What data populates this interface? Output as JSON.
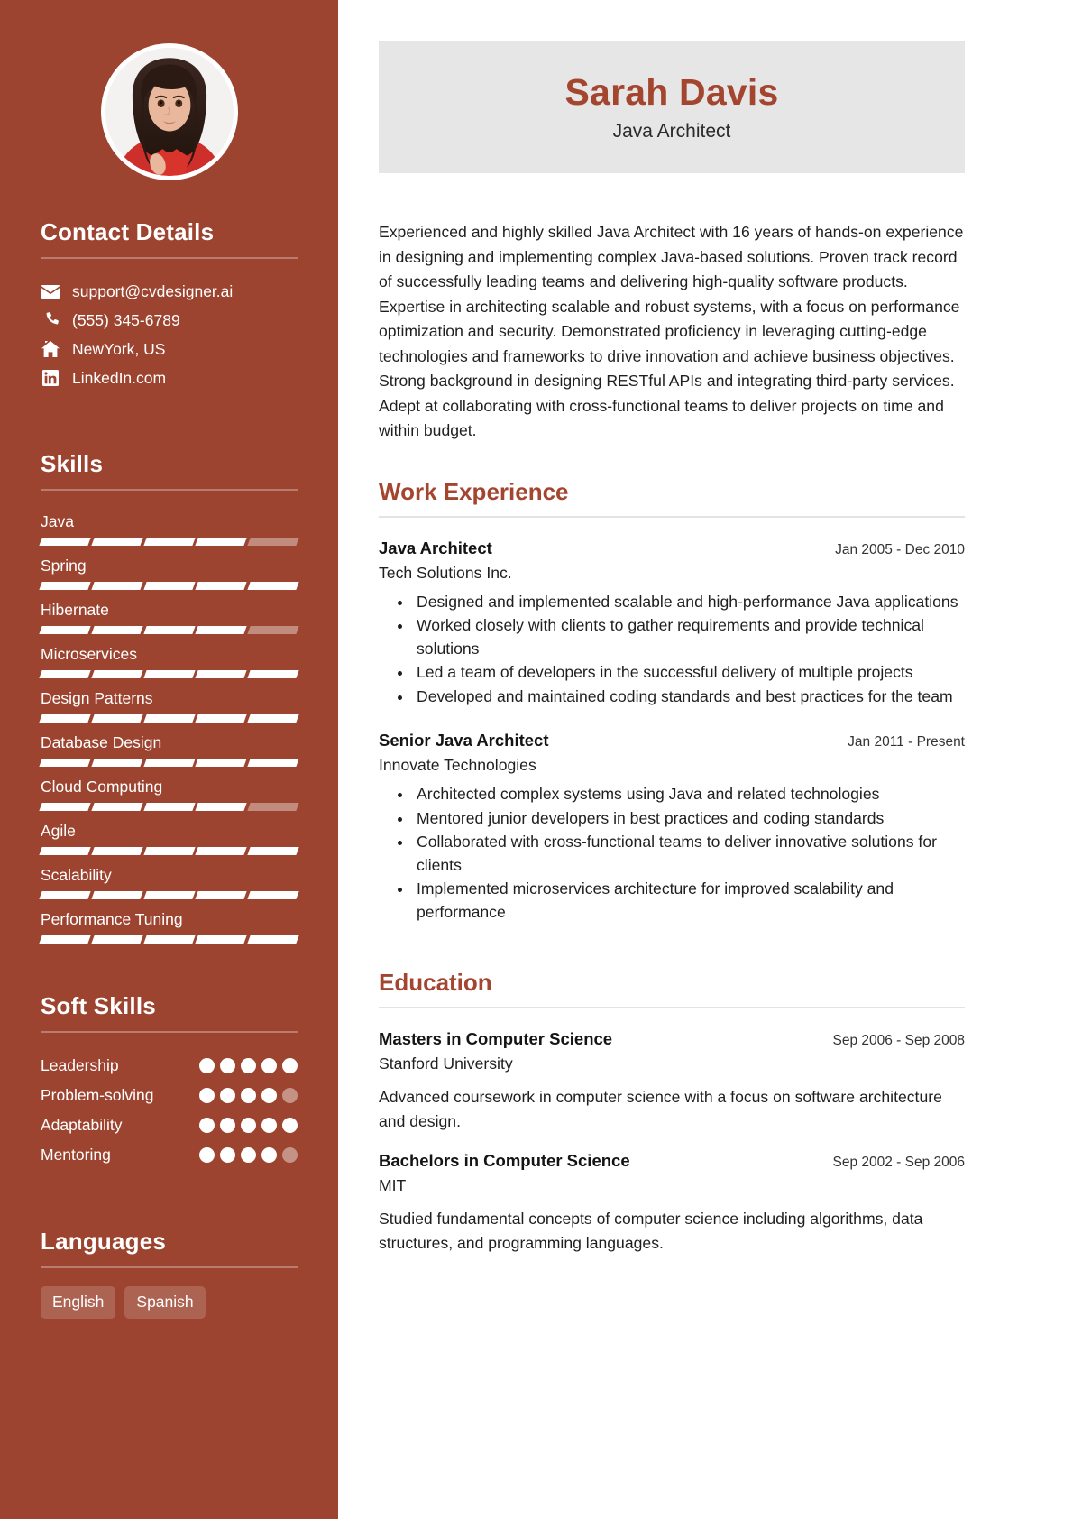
{
  "theme": {
    "sidebar_bg": "#9c4430",
    "accent": "#a3452f",
    "banner_bg": "#e6e6e6",
    "text": "#1f1f1f"
  },
  "header": {
    "name": "Sarah Davis",
    "job_title": "Java Architect"
  },
  "summary": "Experienced and highly skilled Java Architect with 16 years of hands-on experience in designing and implementing complex Java-based solutions. Proven track record of successfully leading teams and delivering high-quality software products. Expertise in architecting scalable and robust systems, with a focus on performance optimization and security. Demonstrated proficiency in leveraging cutting-edge technologies and frameworks to drive innovation and achieve business objectives. Strong background in designing RESTful APIs and integrating third-party services. Adept at collaborating with cross-functional teams to deliver projects on time and within budget.",
  "sidebar": {
    "avatar_alt": "profile-photo",
    "contact": {
      "heading": "Contact Details",
      "items": [
        {
          "icon": "email-icon",
          "value": "support@cvdesigner.ai"
        },
        {
          "icon": "phone-icon",
          "value": "(555) 345-6789"
        },
        {
          "icon": "home-icon",
          "value": "NewYork, US"
        },
        {
          "icon": "linkedin-icon",
          "value": "LinkedIn.com"
        }
      ]
    },
    "skills": {
      "heading": "Skills",
      "max": 5,
      "items": [
        {
          "name": "Java",
          "level": 4
        },
        {
          "name": "Spring",
          "level": 5
        },
        {
          "name": "Hibernate",
          "level": 4
        },
        {
          "name": "Microservices",
          "level": 5
        },
        {
          "name": "Design Patterns",
          "level": 5
        },
        {
          "name": "Database Design",
          "level": 5
        },
        {
          "name": "Cloud Computing",
          "level": 4
        },
        {
          "name": "Agile",
          "level": 5
        },
        {
          "name": "Scalability",
          "level": 5
        },
        {
          "name": "Performance Tuning",
          "level": 5
        }
      ]
    },
    "soft_skills": {
      "heading": "Soft Skills",
      "max": 5,
      "items": [
        {
          "name": "Leadership",
          "level": 5
        },
        {
          "name": "Problem-solving",
          "level": 4
        },
        {
          "name": "Adaptability",
          "level": 5
        },
        {
          "name": "Mentoring",
          "level": 4
        }
      ]
    },
    "languages": {
      "heading": "Languages",
      "items": [
        "English",
        "Spanish"
      ]
    }
  },
  "main": {
    "work": {
      "heading": "Work Experience",
      "entries": [
        {
          "role": "Java Architect",
          "org": "Tech Solutions Inc.",
          "date": "Jan 2005 - Dec 2010",
          "bullets": [
            "Designed and implemented scalable and high-performance Java applications",
            "Worked closely with clients to gather requirements and provide technical solutions",
            "Led a team of developers in the successful delivery of multiple projects",
            "Developed and maintained coding standards and best practices for the team"
          ]
        },
        {
          "role": "Senior Java Architect",
          "org": "Innovate Technologies",
          "date": "Jan 2011 - Present",
          "bullets": [
            "Architected complex systems using Java and related technologies",
            "Mentored junior developers in best practices and coding standards",
            "Collaborated with cross-functional teams to deliver innovative solutions for clients",
            "Implemented microservices architecture for improved scalability and performance"
          ]
        }
      ]
    },
    "education": {
      "heading": "Education",
      "entries": [
        {
          "degree": "Masters in Computer Science",
          "school": "Stanford University",
          "date": "Sep 2006 - Sep 2008",
          "description": "Advanced coursework in computer science with a focus on software architecture and design."
        },
        {
          "degree": "Bachelors in Computer Science",
          "school": "MIT",
          "date": "Sep 2002 - Sep 2006",
          "description": "Studied fundamental concepts of computer science including algorithms, data structures, and programming languages."
        }
      ]
    }
  }
}
